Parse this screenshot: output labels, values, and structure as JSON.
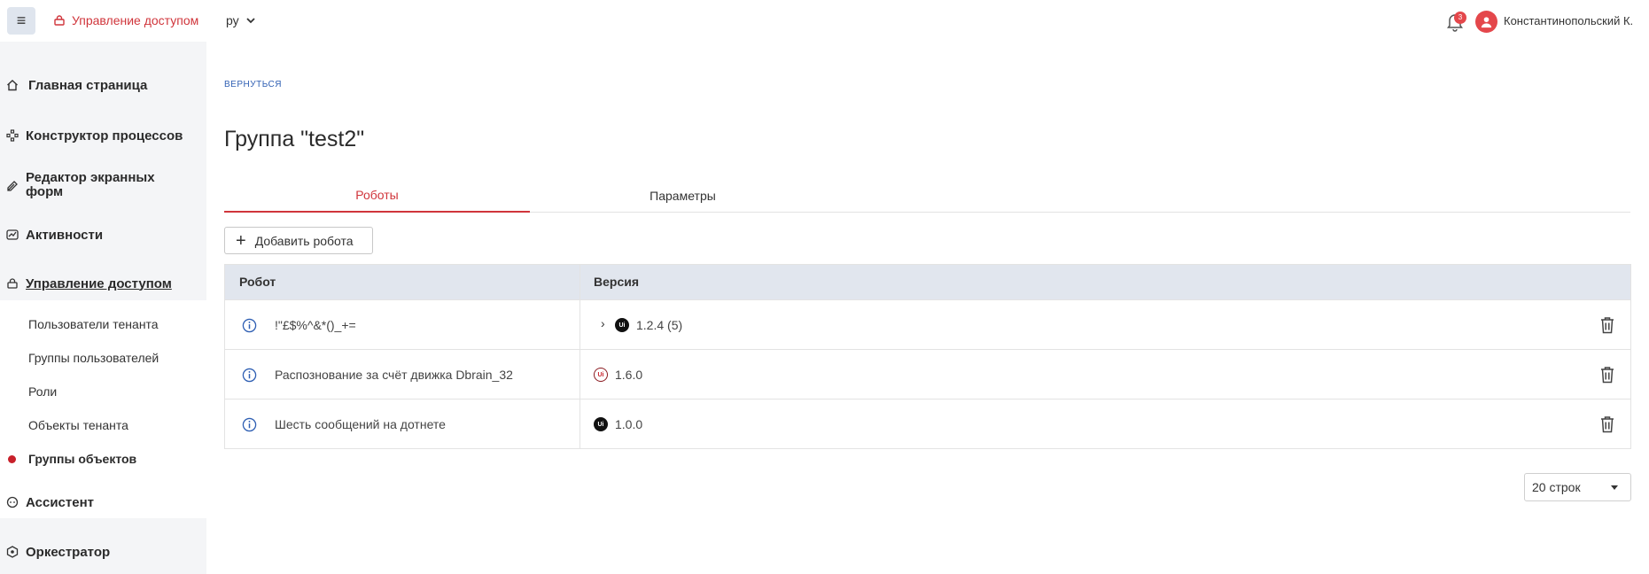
{
  "topbar": {
    "menu_icon": "menu-icon",
    "section_label": "Управление доступом",
    "language": "ру",
    "notifications_count": "3",
    "user_name": "Константинопольский К."
  },
  "sidebar": {
    "items": [
      {
        "label": "Главная страница",
        "icon": "home-icon"
      },
      {
        "label": "Конструктор процессов",
        "icon": "process-icon"
      },
      {
        "label": "Редактор экранных форм",
        "icon": "form-editor-icon"
      },
      {
        "label": "Активности",
        "icon": "activity-icon"
      },
      {
        "label": "Управление доступом",
        "icon": "access-icon"
      },
      {
        "label": "Ассистент",
        "icon": "assistant-icon"
      },
      {
        "label": "Оркестратор",
        "icon": "orchestrator-icon"
      }
    ],
    "sub_items": [
      {
        "label": "Пользователи тенанта"
      },
      {
        "label": "Группы пользователей"
      },
      {
        "label": "Роли"
      },
      {
        "label": "Объекты тенанта"
      },
      {
        "label": "Группы объектов"
      }
    ]
  },
  "main": {
    "back_label": "ВЕРНУТЬСЯ",
    "title": "Группа \"test2\"",
    "tabs": [
      {
        "label": "Роботы",
        "active": true
      },
      {
        "label": "Параметры",
        "active": false
      }
    ],
    "add_button_label": "Добавить робота",
    "table": {
      "columns": [
        "Робот",
        "Версия"
      ],
      "rows": [
        {
          "name": "!\"£$%^&*()_+=",
          "version": "1.2.4 (5)",
          "expandable": true,
          "icon_style": "dark"
        },
        {
          "name": "Распознование за счёт движка Dbrain_32",
          "version": "1.6.0",
          "expandable": false,
          "icon_style": "outlined-red"
        },
        {
          "name": "Шесть сообщений на дотнете",
          "version": "1.0.0",
          "expandable": false,
          "icon_style": "dark"
        }
      ]
    },
    "rows_per_page": "20 строк"
  },
  "colors": {
    "accent": "#d0353b",
    "link": "#2f5fb3",
    "header_bg": "#e1e6ee",
    "sidebar_bg": "#f4f5f7"
  }
}
